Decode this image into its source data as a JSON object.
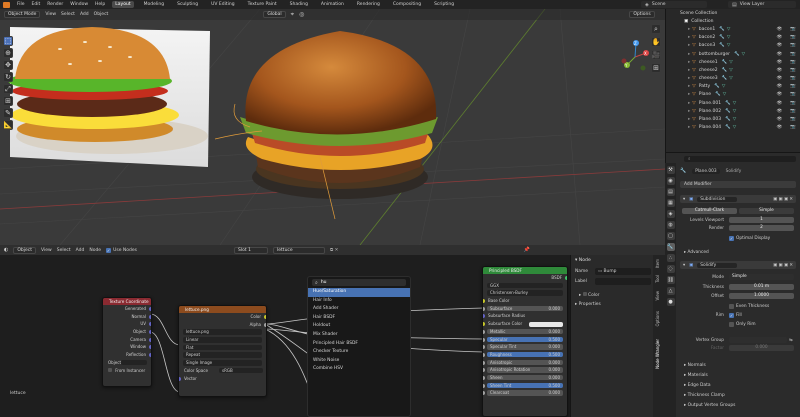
{
  "topbar": {
    "menus": [
      "File",
      "Edit",
      "Render",
      "Window",
      "Help"
    ],
    "workspaces": [
      "Layout",
      "Modeling",
      "Sculpting",
      "UV Editing",
      "Texture Paint",
      "Shading",
      "Animation",
      "Rendering",
      "Compositing",
      "Scripting"
    ],
    "active_workspace": "Layout",
    "scene": "Scene",
    "view_layer": "View Layer"
  },
  "viewport": {
    "mode": "Object Mode",
    "menus": [
      "View",
      "Select",
      "Add",
      "Object"
    ],
    "transform": "Global",
    "options": "Options",
    "gizmo": {
      "x": "X",
      "y": "Y",
      "z": "Z"
    }
  },
  "outliner": {
    "header": "Scene Collection",
    "collection": "Collection",
    "items": [
      "bacon1",
      "bacon2",
      "bacon3",
      "bottomburger",
      "cheese1",
      "cheese2",
      "cheese3",
      "Patty",
      "Plane",
      "Plane.001",
      "Plane.002",
      "Plane.003",
      "Plane.004"
    ]
  },
  "properties": {
    "object_name": "Plane.003",
    "modifier_ref": "Solidify",
    "add_modifier": "Add Modifier",
    "subdivision": {
      "name": "Subdivision",
      "mode_catmull": "Catmull-Clark",
      "mode_simple": "Simple",
      "levels_label": "Levels Viewport",
      "levels": "1",
      "render_label": "Render",
      "render": "2",
      "optimal": "Optimal Display",
      "advanced": "Advanced"
    },
    "solidify": {
      "name": "Solidify",
      "mode_label": "Mode",
      "mode": "Simple",
      "thickness_label": "Thickness",
      "thickness": "0.01 m",
      "offset_label": "Offset",
      "offset": "1.0000",
      "even": "Even Thickness",
      "rim_label": "Rim",
      "fill": "Fill",
      "only_rim": "Only Rim",
      "vertex_group": "Vertex Group",
      "factor_label": "Factor",
      "factor": "0.000"
    },
    "panels": [
      "Normals",
      "Materials",
      "Edge Data",
      "Thickness Clamp",
      "Output Vertex Groups"
    ]
  },
  "node_editor": {
    "header": {
      "type": "Object",
      "menus": [
        "View",
        "Select",
        "Add",
        "Node"
      ],
      "use_nodes": "Use Nodes",
      "slot": "Slot 1",
      "material": "lettuce"
    },
    "breadcrumb": "lettuce",
    "texcoord": {
      "title": "Texture Coordinate",
      "outputs": [
        "Generated",
        "Normal",
        "UV",
        "Object",
        "Camera",
        "Window",
        "Reflection"
      ],
      "object_label": "Object:",
      "from_instancer": "From Instancer"
    },
    "image": {
      "title": "lettuce.png",
      "outputs": [
        "Color",
        "Alpha"
      ],
      "file": "lettuce.png",
      "interp": "Linear",
      "proj": "Flat",
      "ext": "Repeat",
      "source": "Single Image",
      "cs_label": "Color Space",
      "cs": "sRGB",
      "vector": "Vector"
    },
    "bsdf": {
      "title": "Principled BSDF",
      "out": "BSDF",
      "dist": "GGX",
      "sss": "Christensen-Burley",
      "rows": [
        {
          "name": "Base Color"
        },
        {
          "name": "Subsurface",
          "value": "0.000"
        },
        {
          "name": "Subsurface Radius"
        },
        {
          "name": "Subsurface Color"
        },
        {
          "name": "Metallic",
          "value": "0.000"
        },
        {
          "name": "Specular",
          "value": "0.500"
        },
        {
          "name": "Specular Tint",
          "value": "0.000"
        },
        {
          "name": "Roughness",
          "value": "0.500"
        },
        {
          "name": "Anisotropic",
          "value": "0.000"
        },
        {
          "name": "Anisotropic Rotation",
          "value": "0.000"
        },
        {
          "name": "Sheen",
          "value": "0.000"
        },
        {
          "name": "Sheen Tint",
          "value": "0.500"
        },
        {
          "name": "Clearcoat",
          "value": "0.000"
        }
      ]
    },
    "search": {
      "query": "hu",
      "results": [
        "Hue/Saturation",
        "Hair Info",
        "Add Shader",
        "Hair BSDF",
        "Holdout",
        "Mix Shader",
        "Principled Hair BSDF",
        "Checker Texture",
        "White Noise",
        "Combine HSV"
      ]
    },
    "sidebar": {
      "title": "Node",
      "name_label": "Name",
      "name": "Bump",
      "label_label": "Label",
      "color": "Color",
      "properties": "Properties"
    },
    "tabs": [
      "Item",
      "Tool",
      "View",
      "Options",
      "Node Wrangler"
    ]
  }
}
